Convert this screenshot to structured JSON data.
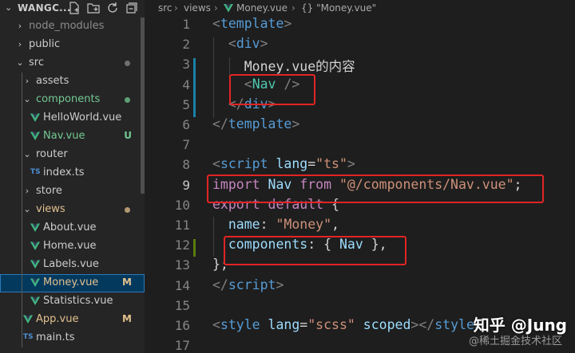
{
  "explorer": {
    "title": "WANGC...",
    "tree": [
      {
        "label": "node_modules",
        "kind": "folder",
        "open": false,
        "depth": 0,
        "color": "#8c8c8c"
      },
      {
        "label": "public",
        "kind": "folder",
        "open": false,
        "depth": 0,
        "color": "#cccccc"
      },
      {
        "label": "src",
        "kind": "folder",
        "open": true,
        "depth": 0,
        "color": "#cccccc",
        "dot": true
      },
      {
        "label": "assets",
        "kind": "folder",
        "open": false,
        "depth": 1,
        "color": "#cccccc"
      },
      {
        "label": "components",
        "kind": "folder",
        "open": true,
        "depth": 1,
        "color": "#73c991",
        "dot": true
      },
      {
        "label": "HelloWorld.vue",
        "kind": "vue",
        "depth": 2,
        "color": "#cccccc"
      },
      {
        "label": "Nav.vue",
        "kind": "vue",
        "depth": 2,
        "color": "#73c991",
        "badge": "U"
      },
      {
        "label": "router",
        "kind": "folder",
        "open": true,
        "depth": 1,
        "color": "#cccccc"
      },
      {
        "label": "index.ts",
        "kind": "ts",
        "depth": 2,
        "color": "#cccccc"
      },
      {
        "label": "store",
        "kind": "folder",
        "open": false,
        "depth": 1,
        "color": "#cccccc"
      },
      {
        "label": "views",
        "kind": "folder",
        "open": true,
        "depth": 1,
        "color": "#e2c08d",
        "dot": true
      },
      {
        "label": "About.vue",
        "kind": "vue",
        "depth": 2,
        "color": "#cccccc"
      },
      {
        "label": "Home.vue",
        "kind": "vue",
        "depth": 2,
        "color": "#cccccc"
      },
      {
        "label": "Labels.vue",
        "kind": "vue",
        "depth": 2,
        "color": "#cccccc"
      },
      {
        "label": "Money.vue",
        "kind": "vue",
        "depth": 2,
        "color": "#e2c08d",
        "badge": "M",
        "selected": true
      },
      {
        "label": "Statistics.vue",
        "kind": "vue",
        "depth": 2,
        "color": "#cccccc"
      },
      {
        "label": "App.vue",
        "kind": "vue",
        "depth": 1,
        "color": "#e2c08d",
        "badge": "M"
      },
      {
        "label": "main.ts",
        "kind": "ts",
        "depth": 1,
        "color": "#cccccc"
      }
    ]
  },
  "breadcrumb": {
    "items": [
      "src",
      "views",
      "Money.vue",
      "{} \"Money.vue\""
    ]
  },
  "editor": {
    "lines": [
      {
        "n": "1",
        "tokens": [
          [
            "t-bracket",
            "<"
          ],
          [
            "t-tag",
            "template"
          ],
          [
            "t-bracket",
            ">"
          ]
        ]
      },
      {
        "n": "2",
        "tokens": [
          [
            "t-txt",
            "  "
          ],
          [
            "t-bracket",
            "<"
          ],
          [
            "t-tag",
            "div"
          ],
          [
            "t-bracket",
            ">"
          ]
        ]
      },
      {
        "n": "3",
        "tokens": [
          [
            "t-txt",
            "    Money.vue的内容"
          ]
        ]
      },
      {
        "n": "4",
        "tokens": [
          [
            "t-txt",
            "    "
          ],
          [
            "t-bracket",
            "<"
          ],
          [
            "t-comp",
            "Nav"
          ],
          [
            "t-txt",
            " "
          ],
          [
            "t-bracket",
            "/>"
          ]
        ]
      },
      {
        "n": "5",
        "tokens": [
          [
            "t-txt",
            "  "
          ],
          [
            "t-bracket",
            "</"
          ],
          [
            "t-tag",
            "div"
          ],
          [
            "t-bracket",
            ">"
          ]
        ]
      },
      {
        "n": "6",
        "tokens": [
          [
            "t-bracket",
            "</"
          ],
          [
            "t-tag",
            "template"
          ],
          [
            "t-bracket",
            ">"
          ]
        ]
      },
      {
        "n": "7",
        "tokens": []
      },
      {
        "n": "8",
        "tokens": [
          [
            "t-bracket",
            "<"
          ],
          [
            "t-tag",
            "script"
          ],
          [
            "t-txt",
            " "
          ],
          [
            "t-attr",
            "lang"
          ],
          [
            "t-txt",
            "="
          ],
          [
            "t-str",
            "\"ts\""
          ],
          [
            "t-bracket",
            ">"
          ]
        ]
      },
      {
        "n": "9",
        "tokens": [
          [
            "t-kw",
            "import"
          ],
          [
            "t-txt",
            " "
          ],
          [
            "t-prop",
            "Nav"
          ],
          [
            "t-txt",
            " "
          ],
          [
            "t-kw",
            "from"
          ],
          [
            "t-txt",
            " "
          ],
          [
            "t-str",
            "\"@/components/Nav.vue\""
          ],
          [
            "t-txt",
            ";"
          ]
        ]
      },
      {
        "n": "10",
        "tokens": [
          [
            "t-kw",
            "export"
          ],
          [
            "t-txt",
            " "
          ],
          [
            "t-kw",
            "default"
          ],
          [
            "t-txt",
            " {"
          ]
        ]
      },
      {
        "n": "11",
        "tokens": [
          [
            "t-txt",
            "  "
          ],
          [
            "t-prop",
            "name"
          ],
          [
            "t-txt",
            ": "
          ],
          [
            "t-str",
            "\"Money\""
          ],
          [
            "t-txt",
            ","
          ]
        ]
      },
      {
        "n": "12",
        "tokens": [
          [
            "t-txt",
            "  "
          ],
          [
            "t-prop",
            "components"
          ],
          [
            "t-txt",
            ": { "
          ],
          [
            "t-prop",
            "Nav"
          ],
          [
            "t-txt",
            " },"
          ]
        ]
      },
      {
        "n": "13",
        "tokens": [
          [
            "t-txt",
            "};"
          ]
        ]
      },
      {
        "n": "14",
        "tokens": [
          [
            "t-bracket",
            "</"
          ],
          [
            "t-tag",
            "script"
          ],
          [
            "t-bracket",
            ">"
          ]
        ]
      },
      {
        "n": "15",
        "tokens": []
      },
      {
        "n": "16",
        "tokens": [
          [
            "t-bracket",
            "<"
          ],
          [
            "t-tag",
            "style"
          ],
          [
            "t-txt",
            " "
          ],
          [
            "t-attr",
            "lang"
          ],
          [
            "t-txt",
            "="
          ],
          [
            "t-str",
            "\"scss\""
          ],
          [
            "t-txt",
            " "
          ],
          [
            "t-attr",
            "scoped"
          ],
          [
            "t-bracket",
            "></"
          ],
          [
            "t-tag",
            "style"
          ],
          [
            "t-bracket",
            ">"
          ]
        ]
      },
      {
        "n": "17",
        "tokens": []
      }
    ],
    "active_line": "9"
  },
  "watermark": {
    "text": "知乎 @Jung",
    "subtext": "@稀土掘金技术社区"
  },
  "colors": {
    "highlight_box": "#e32424",
    "modified_gutter": "#1b81a8",
    "added_gutter": "#587c0c"
  }
}
